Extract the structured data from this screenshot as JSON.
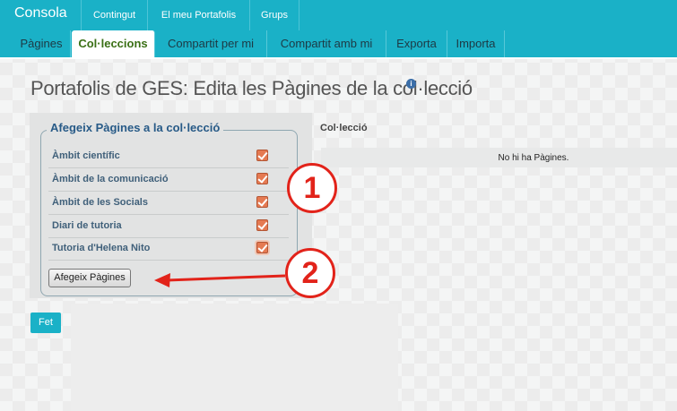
{
  "topnav": {
    "brand": "Consola",
    "tabs": [
      "Contingut",
      "El meu Portafolis",
      "Grups"
    ]
  },
  "subnav": {
    "tabs": [
      "Pàgines",
      "Col·leccions",
      "Compartit per mi",
      "Compartit amb mi",
      "Exporta",
      "Importa"
    ],
    "active": "Col·leccions"
  },
  "page": {
    "title": "Portafolis de GES: Edita les Pàgines de la col·lecció",
    "info_icon": "info-icon"
  },
  "add_pages": {
    "legend": "Afegeix Pàgines a la col·lecció",
    "items": [
      {
        "label": "Àmbit científic",
        "checked": true
      },
      {
        "label": "Àmbit de la comunicació",
        "checked": true
      },
      {
        "label": "Àmbit de les Socials",
        "checked": true
      },
      {
        "label": "Diari de tutoria",
        "checked": true
      },
      {
        "label": "Tutoria d'Helena Nito",
        "checked": true
      }
    ],
    "button_label": "Afegeix Pàgines"
  },
  "collection": {
    "header": "Col·lecció",
    "empty_text": "No hi ha Pàgines."
  },
  "done_label": "Fet",
  "annotations": {
    "one": "1",
    "two": "2",
    "color": "#e2231a"
  }
}
